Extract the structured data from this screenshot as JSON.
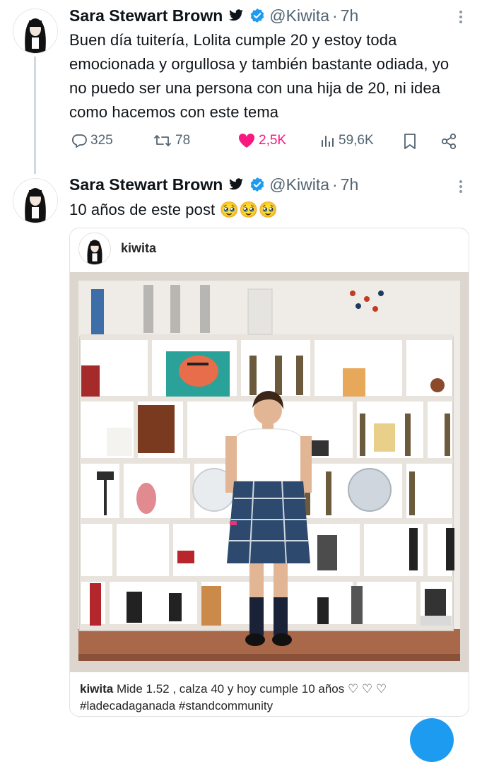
{
  "tweets": [
    {
      "author_name": "Sara Stewart Brown",
      "handle": "@Kiwita",
      "separator": "·",
      "time": "7h",
      "text": "Buen día tuitería, Lolita cumple 20 y estoy toda emocionada y orgullosa y también bastante odiada, yo no puedo ser una persona con una hija de 20, ni idea como hacemos con este tema",
      "stats": {
        "replies": "325",
        "retweets": "78",
        "likes": "2,5K",
        "views": "59,6K"
      }
    },
    {
      "author_name": "Sara Stewart Brown",
      "handle": "@Kiwita",
      "separator": "·",
      "time": "7h",
      "text": "10 años de este post 🥹🥹🥹",
      "embed": {
        "username": "kiwita",
        "caption_user": "kiwita",
        "caption_text": "Mide 1.52 , calza 40 y hoy cumple 10 años ♡ ♡ ♡",
        "caption_tags": "#ladecadaganada #standcommunity"
      }
    }
  ],
  "colors": {
    "like_active": "#f91880",
    "verified": "#1d9bf0",
    "muted": "#536471"
  },
  "icons": [
    "bird-icon",
    "verified-badge-icon",
    "more-icon",
    "reply-icon",
    "retweet-icon",
    "heart-icon",
    "views-icon",
    "bookmark-icon",
    "share-icon"
  ]
}
